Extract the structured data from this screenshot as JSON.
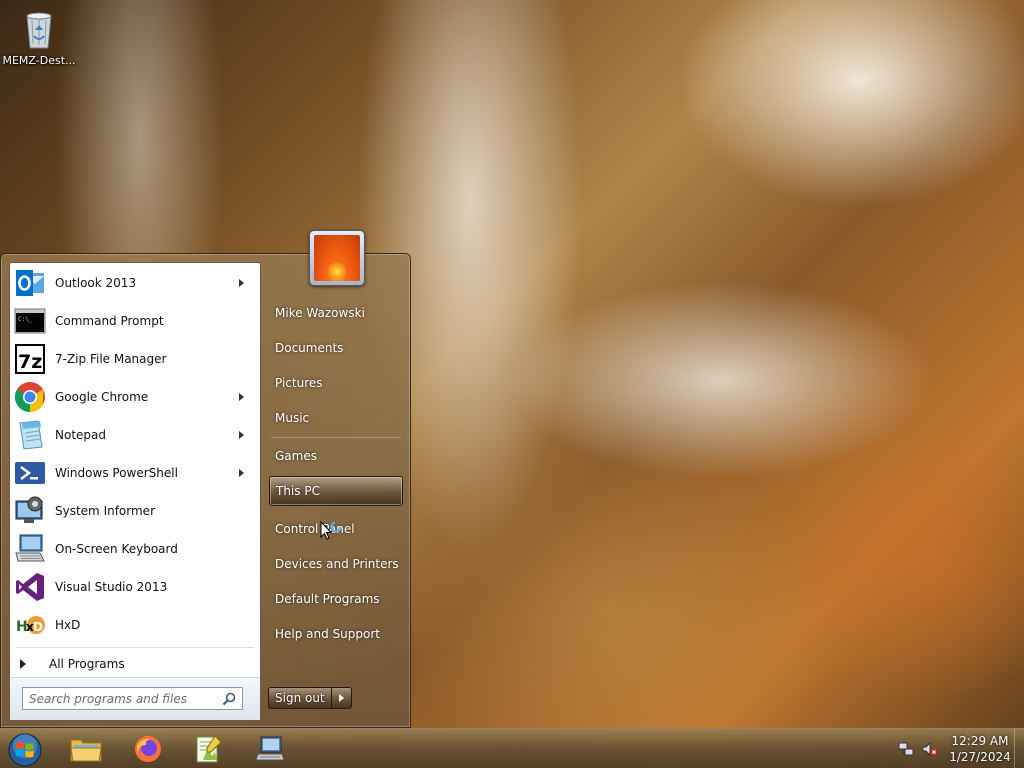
{
  "desktop": {
    "icons": [
      {
        "label": "MEMZ-Dest...",
        "icon": "recycle-bin-icon"
      }
    ]
  },
  "start_menu": {
    "pinned_programs": [
      {
        "label": "Outlook 2013",
        "icon": "outlook-icon",
        "has_submenu": true
      },
      {
        "label": "Command Prompt",
        "icon": "command-prompt-icon",
        "has_submenu": false
      },
      {
        "label": "7-Zip File Manager",
        "icon": "7zip-icon",
        "has_submenu": false
      },
      {
        "label": "Google Chrome",
        "icon": "chrome-icon",
        "has_submenu": true
      },
      {
        "label": "Notepad",
        "icon": "notepad-icon",
        "has_submenu": true
      },
      {
        "label": "Windows PowerShell",
        "icon": "powershell-icon",
        "has_submenu": true
      },
      {
        "label": "System Informer",
        "icon": "system-informer-icon",
        "has_submenu": false
      },
      {
        "label": "On-Screen Keyboard",
        "icon": "keyboard-icon",
        "has_submenu": false
      },
      {
        "label": "Visual Studio 2013",
        "icon": "visual-studio-icon",
        "has_submenu": false
      },
      {
        "label": "HxD",
        "icon": "hxd-icon",
        "has_submenu": false
      }
    ],
    "all_programs_label": "All Programs",
    "search": {
      "placeholder": "Search programs and files",
      "value": ""
    },
    "right_items": [
      {
        "label": "Mike Wazowski",
        "highlighted": false
      },
      {
        "label": "Documents",
        "highlighted": false
      },
      {
        "label": "Pictures",
        "highlighted": false
      },
      {
        "label": "Music",
        "highlighted": false
      },
      {
        "label": "Games",
        "highlighted": false
      },
      {
        "label": "This PC",
        "highlighted": true
      },
      {
        "label": "Control Panel",
        "highlighted": false
      },
      {
        "label": "Devices and Printers",
        "highlighted": false
      },
      {
        "label": "Default Programs",
        "highlighted": false
      },
      {
        "label": "Help and Support",
        "highlighted": false
      }
    ],
    "sign_out_label": "Sign out"
  },
  "taskbar": {
    "start_icon": "windows-orb-icon",
    "pinned": [
      {
        "icon": "file-explorer-icon"
      },
      {
        "icon": "firefox-icon"
      },
      {
        "icon": "notepad-plus-plus-icon"
      },
      {
        "icon": "network-computer-icon"
      }
    ],
    "tray": [
      {
        "icon": "network-icon"
      },
      {
        "icon": "volume-muted-icon"
      }
    ],
    "clock": {
      "time": "12:29 AM",
      "date": "1/27/2024"
    }
  },
  "colors": {
    "chrome_red": "#db4437",
    "chrome_yellow": "#f4c20d",
    "chrome_green": "#0f9d58",
    "chrome_blue": "#4285f4",
    "outlook_blue": "#0072c6",
    "vs_purple": "#68217a",
    "powershell_blue": "#2d5aa0"
  }
}
